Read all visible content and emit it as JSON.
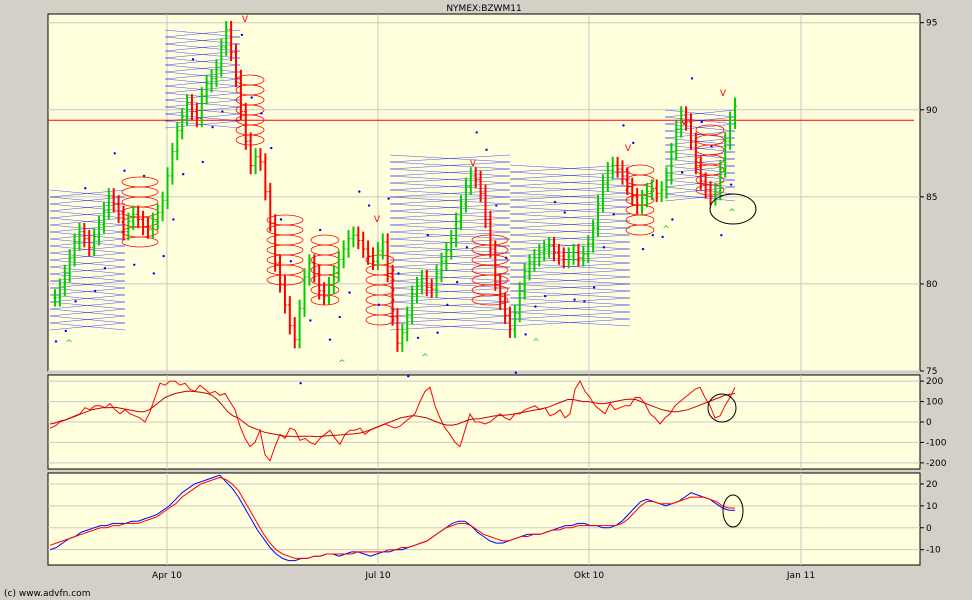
{
  "chart_data": [
    {
      "type": "line",
      "panel": "price",
      "title": "NYMEX:BZWM11",
      "xlabels": [
        "Apr 10",
        "Jul 10",
        "Okt 10",
        "Jan 11"
      ],
      "yticks": [
        "95",
        "90",
        "85",
        "80",
        "75"
      ],
      "ylim": [
        75,
        95.5
      ],
      "reference_line": 89.4,
      "grid": true,
      "series": [
        {
          "values": [
            79.2,
            79.8,
            80.6,
            81.5,
            82.4,
            83.0,
            82.6,
            82.1,
            82.7,
            83.4,
            84.2,
            85.0,
            84.6,
            84.0,
            83.0,
            83.6,
            84.0,
            83.7,
            83.3,
            83.1,
            83.6,
            84.1,
            84.8,
            86.2,
            87.6,
            88.8,
            89.6,
            90.4,
            89.9,
            89.5,
            90.8,
            91.5,
            91.8,
            92.4,
            93.6,
            94.6,
            93.3,
            91.8,
            89.9,
            88.2,
            86.8,
            87.3,
            87.0,
            85.3,
            83.5,
            81.2,
            80.0,
            78.8,
            77.6,
            76.8,
            78.6,
            80.4,
            81.2,
            80.6,
            79.6,
            79.3,
            79.9,
            80.6,
            81.4,
            82.0,
            82.6,
            82.8,
            82.5,
            82.0,
            81.6,
            81.3,
            81.9,
            82.4,
            80.6,
            78.1,
            76.6,
            77.2,
            78.2,
            79.4,
            79.9,
            80.3,
            79.8,
            79.7,
            80.6,
            81.3,
            81.9,
            82.6,
            83.6,
            84.6,
            85.6,
            86.2,
            86.0,
            85.2,
            83.7,
            82.0,
            80.1,
            79.0,
            78.2,
            77.4,
            78.3,
            79.6,
            80.7,
            81.2,
            81.5,
            81.8,
            82.0,
            82.2,
            81.8,
            81.6,
            81.4,
            81.6,
            81.8,
            81.5,
            81.7,
            82.3,
            83.2,
            84.6,
            85.8,
            86.5,
            86.8,
            86.6,
            86.2,
            85.6,
            85.0,
            84.5,
            84.9,
            85.3,
            85.5,
            85.2,
            85.4,
            86.2,
            87.6,
            88.9,
            89.7,
            89.3,
            88.2,
            86.8,
            85.9,
            85.4,
            85.0,
            85.3,
            86.6,
            88.2,
            89.4,
            90.2
          ]
        }
      ],
      "markers": [
        "V",
        "^"
      ]
    },
    {
      "type": "line",
      "panel": "oscillator-1",
      "yticks": [
        "200",
        "100",
        "0",
        "-100",
        "-200"
      ],
      "ylim": [
        -230,
        230
      ],
      "series": [
        {
          "values": [
            -30,
            -20,
            0,
            10,
            20,
            30,
            40,
            70,
            60,
            80,
            80,
            70,
            90,
            60,
            40,
            60,
            40,
            30,
            20,
            0,
            50,
            120,
            190,
            180,
            200,
            200,
            180,
            190,
            160,
            150,
            180,
            160,
            140,
            150,
            130,
            140,
            100,
            60,
            -20,
            -80,
            -120,
            -100,
            -40,
            -160,
            -190,
            -120,
            -60,
            -80,
            -30,
            -40,
            -90,
            -80,
            -100,
            -110,
            -80,
            -60,
            -40,
            -80,
            -110,
            -60,
            -40,
            -40,
            -30,
            -60,
            -40,
            -30,
            -20,
            -10,
            -20,
            -30,
            -20,
            0,
            20,
            40,
            100,
            150,
            170,
            80,
            20,
            -30,
            -60,
            -100,
            -120,
            -40,
            40,
            0,
            0,
            -10,
            0,
            20,
            40,
            20,
            10,
            40,
            40,
            60,
            70,
            80,
            60,
            70,
            30,
            40,
            60,
            20,
            40,
            160,
            200,
            150,
            120,
            80,
            60,
            40,
            90,
            60,
            70,
            80,
            80,
            120,
            120,
            90,
            40,
            20,
            -10,
            20,
            40,
            80,
            100,
            120,
            140,
            160,
            170,
            120,
            80,
            20,
            30,
            80,
            120,
            170
          ]
        },
        {
          "values": [
            -10,
            -5,
            5,
            10,
            20,
            30,
            40,
            50,
            60,
            65,
            70,
            70,
            72,
            70,
            65,
            60,
            55,
            50,
            50,
            60,
            80,
            100,
            120,
            130,
            140,
            145,
            150,
            150,
            148,
            145,
            140,
            130,
            110,
            80,
            50,
            30,
            20,
            0,
            -20,
            -30,
            -40,
            -50,
            -55,
            -60,
            -65,
            -70,
            -70,
            -72,
            -70,
            -70,
            -70,
            -72,
            -70,
            -68,
            -66,
            -64,
            -62,
            -60,
            -58,
            -55,
            -50,
            -40,
            -30,
            -20,
            -10,
            0,
            10,
            20,
            25,
            30,
            30,
            25,
            20,
            10,
            0,
            -10,
            -15,
            -15,
            -10,
            0,
            10,
            15,
            15,
            20,
            25,
            30,
            32,
            34,
            36,
            40,
            45,
            50,
            55,
            60,
            65,
            70,
            80,
            90,
            100,
            110,
            110,
            105,
            100,
            100,
            95,
            90,
            90,
            95,
            100,
            105,
            110,
            112,
            110,
            100,
            90,
            80,
            70,
            60,
            55,
            50,
            50,
            55,
            60,
            70,
            80,
            90,
            100,
            110,
            120,
            130,
            135,
            140
          ]
        }
      ]
    },
    {
      "type": "line",
      "panel": "oscillator-2",
      "yticks": [
        "20",
        "10",
        "0",
        "-10"
      ],
      "ylim": [
        -17,
        25
      ],
      "series": [
        {
          "values": [
            -10,
            -9,
            -7,
            -5,
            -4,
            -2,
            -1,
            0,
            1,
            1,
            2,
            2,
            2,
            3,
            3,
            4,
            5,
            6,
            8,
            10,
            13,
            16,
            18,
            20,
            21,
            22,
            23,
            24,
            21,
            18,
            14,
            9,
            4,
            -1,
            -5,
            -9,
            -12,
            -14,
            -15,
            -15,
            -14,
            -14,
            -13,
            -13,
            -12,
            -12,
            -13,
            -12,
            -11,
            -11,
            -12,
            -13,
            -12,
            -11,
            -11,
            -10,
            -10,
            -9,
            -8,
            -7,
            -6,
            -4,
            -2,
            0,
            2,
            3,
            3,
            1,
            -2,
            -4,
            -6,
            -7,
            -7,
            -6,
            -5,
            -4,
            -3,
            -3,
            -3,
            -2,
            -1,
            0,
            1,
            1,
            2,
            2,
            1,
            1,
            0,
            0,
            1,
            3,
            6,
            9,
            12,
            13,
            12,
            11,
            10,
            11,
            12,
            14,
            16,
            15,
            14,
            13,
            11,
            9,
            8,
            8
          ]
        },
        {
          "values": [
            -8,
            -7,
            -6,
            -5,
            -4,
            -3,
            -2,
            -1,
            0,
            0,
            1,
            1,
            2,
            2,
            2,
            3,
            4,
            5,
            7,
            9,
            11,
            14,
            16,
            18,
            20,
            21,
            22,
            23,
            22,
            20,
            17,
            12,
            7,
            2,
            -3,
            -7,
            -10,
            -12,
            -13,
            -14,
            -14,
            -14,
            -13,
            -13,
            -12,
            -12,
            -12,
            -12,
            -12,
            -11,
            -11,
            -11,
            -11,
            -11,
            -10,
            -10,
            -9,
            -9,
            -8,
            -7,
            -6,
            -4,
            -2,
            0,
            1,
            2,
            2,
            1,
            -1,
            -3,
            -4,
            -5,
            -6,
            -6,
            -5,
            -4,
            -4,
            -3,
            -3,
            -2,
            -1,
            -1,
            0,
            0,
            1,
            1,
            1,
            1,
            1,
            1,
            1,
            2,
            4,
            7,
            10,
            12,
            12,
            11,
            11,
            11,
            12,
            13,
            14,
            14,
            14,
            13,
            12,
            10,
            9,
            9
          ]
        }
      ]
    }
  ],
  "copyright": "(c) www.advfn.com",
  "colors": {
    "background": "#ffffdd",
    "frame": "#d4d0c8",
    "up": "#00cc00",
    "down": "#ff0000",
    "blue": "#0000ff",
    "red": "#cc0000"
  }
}
